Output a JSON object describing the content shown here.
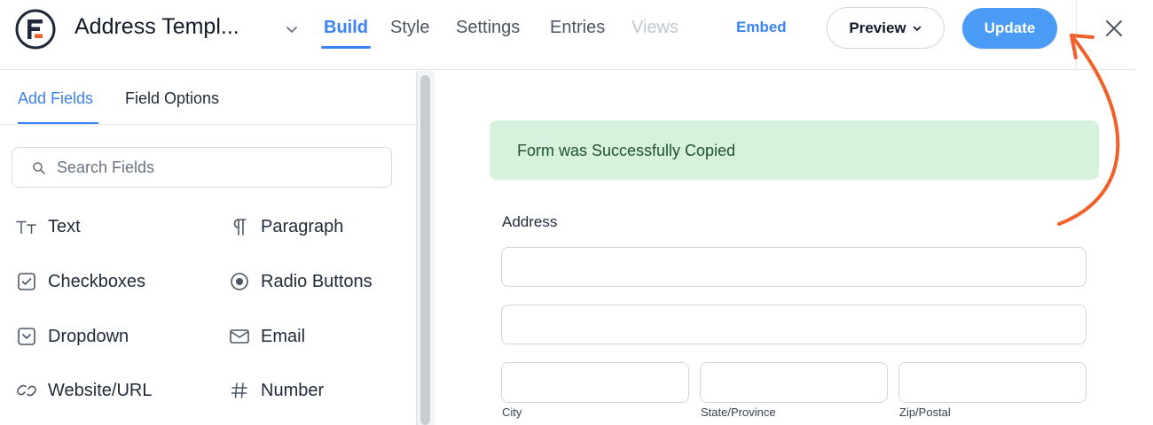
{
  "header": {
    "form_title": "Address Templ...",
    "tabs": [
      {
        "label": "Build",
        "state": "active"
      },
      {
        "label": "Style",
        "state": "normal"
      },
      {
        "label": "Settings",
        "state": "normal"
      },
      {
        "label": "Entries",
        "state": "normal"
      },
      {
        "label": "Views",
        "state": "disabled"
      }
    ],
    "embed_label": "Embed",
    "preview_label": "Preview",
    "update_label": "Update",
    "icons": {
      "logo": "formidable-logo-icon",
      "title_dropdown": "chevron-down-icon",
      "preview_dropdown": "chevron-down-icon",
      "close": "close-icon"
    }
  },
  "sidebar": {
    "tabs": [
      {
        "label": "Add Fields",
        "state": "active"
      },
      {
        "label": "Field Options",
        "state": "normal"
      }
    ],
    "search": {
      "placeholder": "Search Fields",
      "value": "",
      "icon": "search-icon"
    },
    "fields": [
      {
        "label": "Text",
        "icon": "text-icon"
      },
      {
        "label": "Paragraph",
        "icon": "paragraph-icon"
      },
      {
        "label": "Checkboxes",
        "icon": "checkbox-icon"
      },
      {
        "label": "Radio Buttons",
        "icon": "radio-icon"
      },
      {
        "label": "Dropdown",
        "icon": "dropdown-icon"
      },
      {
        "label": "Email",
        "icon": "email-icon"
      },
      {
        "label": "Website/URL",
        "icon": "link-icon"
      },
      {
        "label": "Number",
        "icon": "hash-icon"
      }
    ]
  },
  "main": {
    "success_message": "Form was Successfully Copied",
    "address_field": {
      "label": "Address",
      "sub_labels": [
        "City",
        "State/Province",
        "Zip/Postal"
      ]
    }
  },
  "colors": {
    "accent": "#3b82f6",
    "update_button": "#4a9bf6",
    "success_bg": "#d6f2dc",
    "success_text": "#1f5130",
    "annotation_arrow": "#f0602a"
  }
}
